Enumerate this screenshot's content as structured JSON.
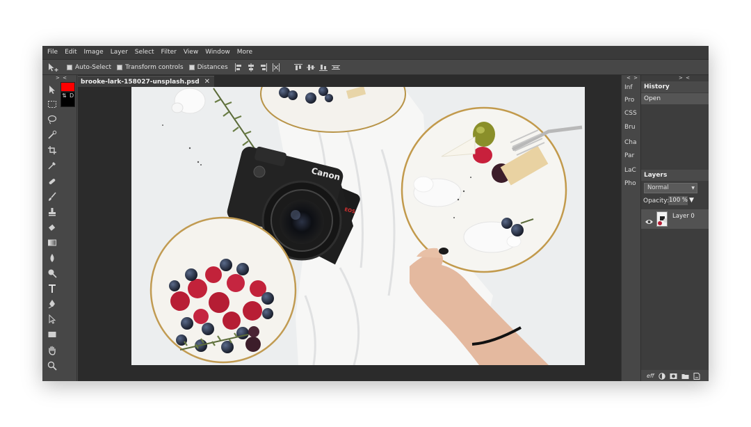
{
  "menu": [
    "File",
    "Edit",
    "Image",
    "Layer",
    "Select",
    "Filter",
    "View",
    "Window",
    "More"
  ],
  "options": {
    "auto_select": "Auto-Select",
    "transform_controls": "Transform controls",
    "distances": "Distances"
  },
  "document": {
    "tab_title": "brooke-lark-158027-unsplash.psd",
    "close_glyph": "✕"
  },
  "swatches": {
    "swap_glyph": "⇅",
    "default_label": "D",
    "fg_color": "#ff0000",
    "bg_color": "#000000"
  },
  "collapse_glyph": "> <",
  "expand_glyph": "< >",
  "narrow_panels": [
    "Inf",
    "Pro",
    "CSS",
    "Bru",
    "Cha",
    "Par",
    "LaC",
    "Pho"
  ],
  "history": {
    "title": "History",
    "items": [
      "Open"
    ]
  },
  "layers": {
    "title": "Layers",
    "blend_mode": "Normal",
    "opacity_label": "Opacity:",
    "opacity_value": "100 %",
    "opacity_arrow": "▼",
    "items": [
      {
        "name": "Layer 0"
      }
    ],
    "footer_fx": "eff"
  },
  "canvas_logos": {
    "camera_brand": "Canon",
    "camera_model": "EOS"
  }
}
